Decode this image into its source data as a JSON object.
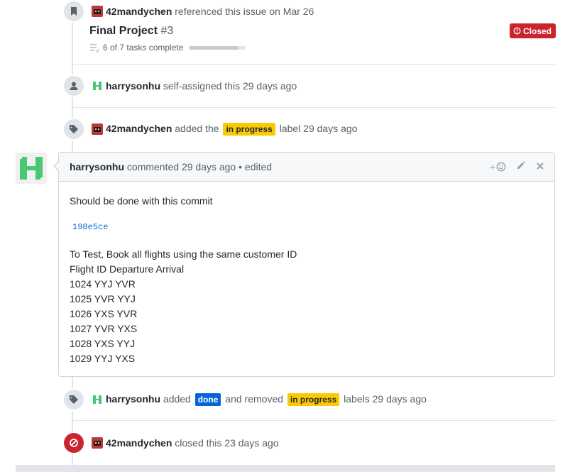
{
  "events": {
    "reference": {
      "author": "42mandychen",
      "text": "referenced this issue on Mar 26",
      "title": "Final Project",
      "number": "#3",
      "state": "Closed",
      "tasks": "6 of 7 tasks complete",
      "progress": 0.857
    },
    "assign": {
      "author": "harrysonhu",
      "text": "self-assigned this 29 days ago"
    },
    "label_add": {
      "author": "42mandychen",
      "pre": "added the",
      "label": "in progress",
      "post": "label 29 days ago"
    },
    "label_change": {
      "author": "harrysonhu",
      "pre": "added",
      "label_added": "done",
      "mid": "and removed",
      "label_removed": "in progress",
      "post": "labels 29 days ago"
    },
    "closed": {
      "author": "42mandychen",
      "text": "closed this 23 days ago"
    }
  },
  "comment": {
    "author": "harrysonhu",
    "meta": "commented 29 days ago • edited",
    "reaction": "+",
    "line1": "Should be done with this commit",
    "commit": "198e5ce",
    "lines": [
      "To Test, Book all flights using the same customer ID",
      "Flight ID Departure Arrival",
      "1024 YYJ YVR",
      "1025 YVR YYJ",
      "1026 YXS YVR",
      "1027 YVR YXS",
      "1028 YXS YYJ",
      "1029 YYJ YXS"
    ]
  },
  "colors": {
    "in_progress": "#fbca04",
    "done": "#0366d6",
    "closed": "#cb2431",
    "avatar_green": "#48c774"
  }
}
